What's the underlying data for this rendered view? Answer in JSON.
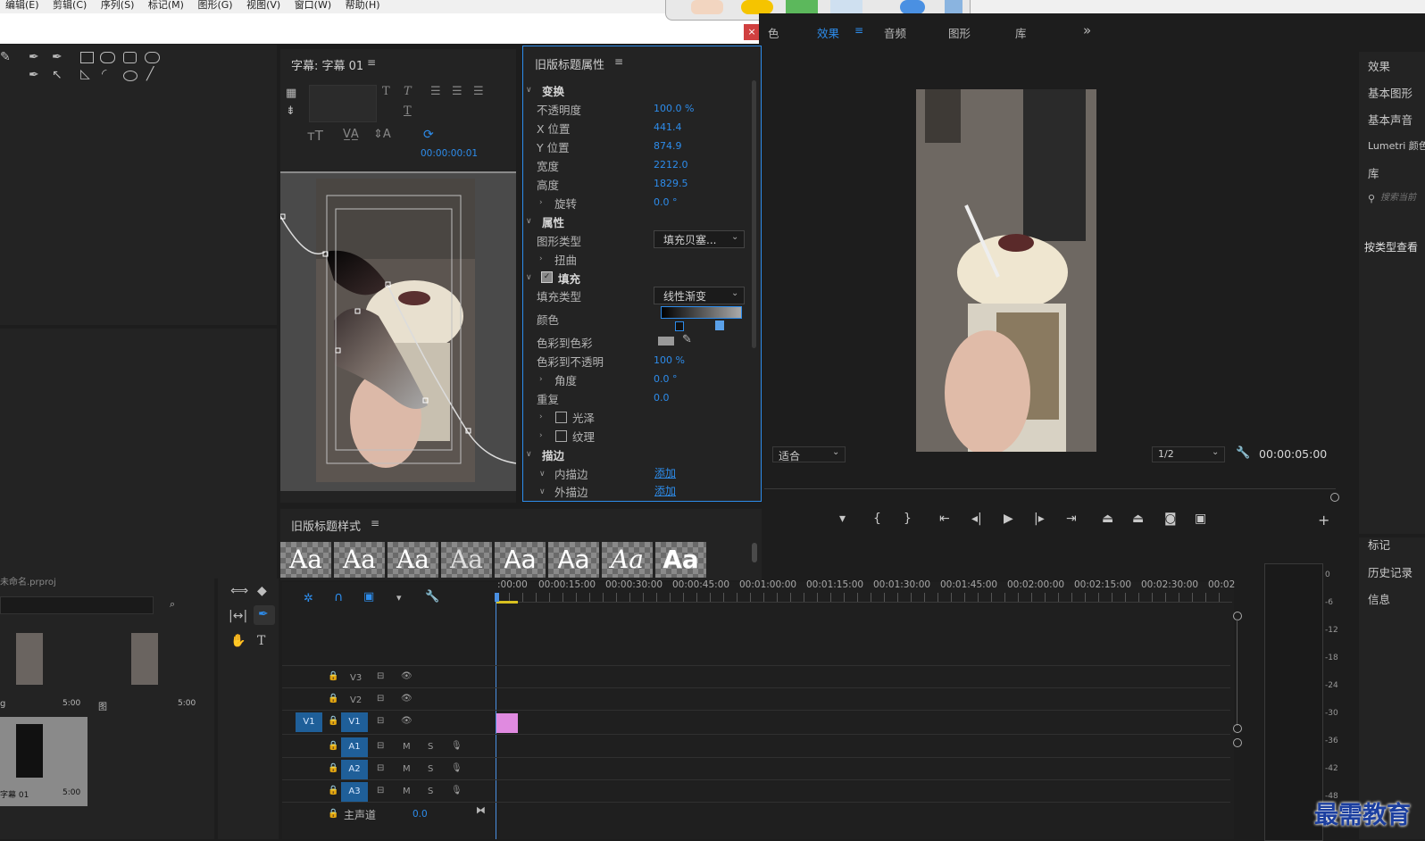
{
  "menu": [
    "编辑(E)",
    "剪辑(C)",
    "序列(S)",
    "标记(M)",
    "图形(G)",
    "视图(V)",
    "窗口(W)",
    "帮助(H)"
  ],
  "workspace_tabs": [
    "色",
    "效果",
    "音频",
    "图形",
    "库"
  ],
  "workspace_more": "»",
  "close_label": "×",
  "titler": {
    "title": "字幕: 字幕 01",
    "timecode": "00:00:00:01"
  },
  "props": {
    "title": "旧版标题属性",
    "transform": "变换",
    "opacity_label": "不透明度",
    "opacity": "100.0 %",
    "x_label": "X 位置",
    "x": "441.4",
    "y_label": "Y 位置",
    "y": "874.9",
    "width_label": "宽度",
    "width": "2212.0",
    "height_label": "高度",
    "height": "1829.5",
    "rotation_label": "旋转",
    "rotation": "0.0 °",
    "attributes": "属性",
    "graphic_type_label": "图形类型",
    "graphic_type": "填充贝塞...",
    "distort": "扭曲",
    "fill": "填充",
    "fill_type_label": "填充类型",
    "fill_type": "线性渐变",
    "color_label": "颜色",
    "color_to_color": "色彩到色彩",
    "color_to_opacity_label": "色彩到不透明",
    "color_to_opacity": "100 %",
    "angle_label": "角度",
    "angle": "0.0 °",
    "repeat_label": "重复",
    "repeat": "0.0",
    "sheen": "光泽",
    "texture": "纹理",
    "stroke": "描边",
    "inner_stroke": "内描边",
    "outer_stroke": "外描边",
    "add": "添加"
  },
  "styles": {
    "title": "旧版标题样式",
    "sample": "Aa"
  },
  "program": {
    "fit": "适合",
    "resolution": "1/2",
    "timecode": "00:00:05:00"
  },
  "right_panel": {
    "items": [
      "效果",
      "基本图形",
      "基本声音",
      "Lumetri 颜色",
      "库"
    ],
    "search_placeholder": "搜索当前",
    "view_by": "按类型查看",
    "bottom": [
      "标记",
      "历史记录",
      "信息"
    ]
  },
  "project": {
    "file": "未命名.prproj",
    "item1": "g",
    "dur1": "5:00",
    "item2": "图",
    "dur2": "5:00",
    "item3": "字幕 01",
    "dur3": "5:00"
  },
  "timeline": {
    "ruler": [
      ":00:00",
      "00:00:15:00",
      "00:00:30:00",
      "00:00:45:00",
      "00:01:00:00",
      "00:01:15:00",
      "00:01:30:00",
      "00:01:45:00",
      "00:02:00:00",
      "00:02:15:00",
      "00:02:30:00",
      "00:02"
    ],
    "tracks": {
      "v3": "V3",
      "v2": "V2",
      "v1": "V1",
      "a1": "A1",
      "a2": "A2",
      "a3": "A3",
      "m": "M",
      "s": "S",
      "master": "主声道",
      "master_val": "0.0"
    }
  },
  "meter": [
    "0",
    "-6",
    "-12",
    "-18",
    "-24",
    "-30",
    "-36",
    "-42",
    "-48"
  ],
  "watermark": "最需教育",
  "colors": {
    "accent": "#2d8ceb",
    "clip": "#e08ae0"
  }
}
